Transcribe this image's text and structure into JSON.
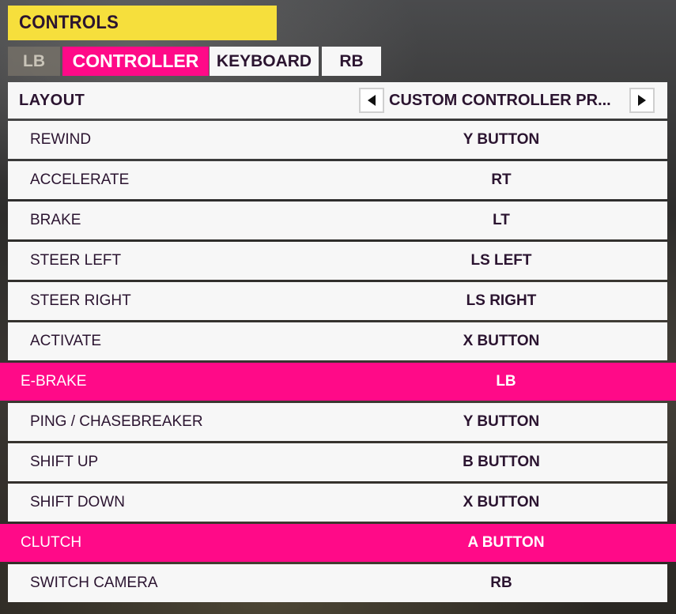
{
  "header": {
    "title": "CONTROLS"
  },
  "tabs": {
    "lb": "LB",
    "controller": "CONTROLLER",
    "keyboard": "KEYBOARD",
    "rb": "RB"
  },
  "layout": {
    "label": "LAYOUT",
    "value": "CUSTOM CONTROLLER PR...",
    "prev_icon": "triangle-left-icon",
    "next_icon": "triangle-right-icon"
  },
  "bindings": [
    {
      "action": "REWIND",
      "binding": "Y BUTTON"
    },
    {
      "action": "ACCELERATE",
      "binding": "RT"
    },
    {
      "action": "BRAKE",
      "binding": "LT"
    },
    {
      "action": "STEER LEFT",
      "binding": "LS LEFT"
    },
    {
      "action": "STEER RIGHT",
      "binding": "LS RIGHT"
    },
    {
      "action": "ACTIVATE",
      "binding": "X BUTTON"
    },
    {
      "action": "E-BRAKE",
      "binding": "LB"
    },
    {
      "action": "PING / CHASEBREAKER",
      "binding": "Y BUTTON"
    },
    {
      "action": "SHIFT UP",
      "binding": "B BUTTON"
    },
    {
      "action": "SHIFT DOWN",
      "binding": "X BUTTON"
    },
    {
      "action": "CLUTCH",
      "binding": "A BUTTON"
    },
    {
      "action": "SWITCH CAMERA",
      "binding": "RB"
    }
  ],
  "colors": {
    "title_yellow": "#f6df3c",
    "accent_pink": "#ff0a88",
    "row_bg": "#f7f7f7",
    "text_dark": "#2b1430"
  }
}
